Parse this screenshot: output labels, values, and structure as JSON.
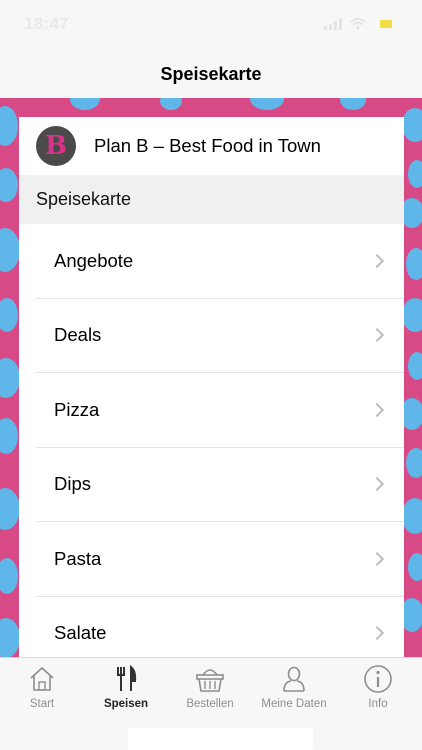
{
  "status_bar": {
    "time": "18:47"
  },
  "nav": {
    "title": "Speisekarte"
  },
  "restaurant": {
    "logo_letter": "B",
    "name": "Plan B – Best Food in Town"
  },
  "menu": {
    "section_title": "Speisekarte",
    "items": [
      {
        "label": "Angebote"
      },
      {
        "label": "Deals"
      },
      {
        "label": "Pizza"
      },
      {
        "label": "Dips"
      },
      {
        "label": "Pasta"
      },
      {
        "label": "Salate"
      }
    ]
  },
  "tabs": [
    {
      "label": "Start",
      "icon": "home-icon",
      "active": false
    },
    {
      "label": "Speisen",
      "icon": "cutlery-icon",
      "active": true
    },
    {
      "label": "Bestellen",
      "icon": "basket-icon",
      "active": false
    },
    {
      "label": "Meine Daten",
      "icon": "user-icon",
      "active": false
    },
    {
      "label": "Info",
      "icon": "info-icon",
      "active": false
    }
  ],
  "colors": {
    "pattern_pink": "#d84a86",
    "pattern_blue": "#5fb6e8",
    "logo_bg": "#4a4a4a",
    "logo_letter": "#d8338a"
  }
}
